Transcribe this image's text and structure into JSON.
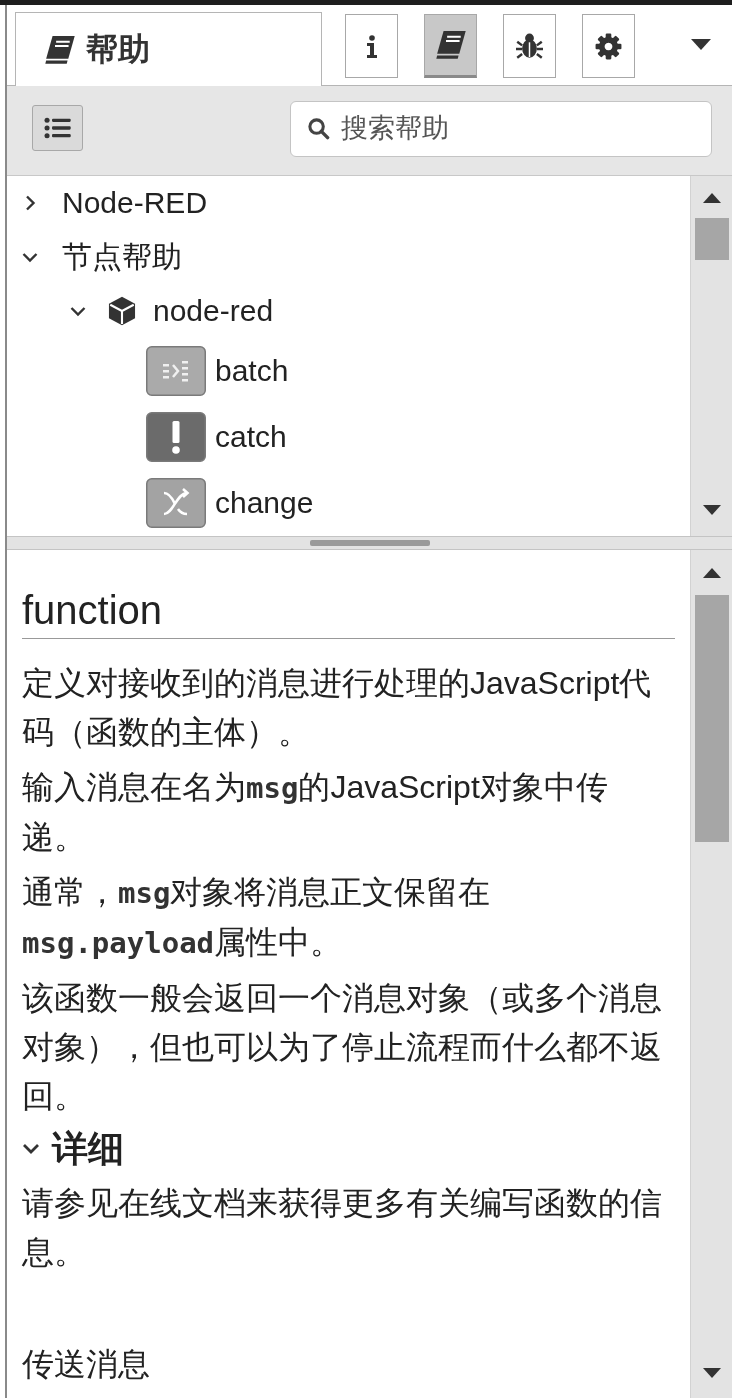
{
  "sidebar_tab": {
    "label": "帮助"
  },
  "sidebar_buttons": [
    {
      "kind": "info",
      "selected": false
    },
    {
      "kind": "book",
      "selected": true
    },
    {
      "kind": "bug",
      "selected": false
    },
    {
      "kind": "gear",
      "selected": false
    }
  ],
  "search": {
    "placeholder": "搜索帮助"
  },
  "tree": [
    {
      "kind": "category",
      "label": "Node-RED",
      "expanded": false
    },
    {
      "kind": "category",
      "label": "节点帮助",
      "expanded": true,
      "children": [
        {
          "kind": "module",
          "label": "node-red",
          "expanded": true,
          "children": [
            {
              "kind": "split",
              "label": "batch",
              "color": "#aaaaaa"
            },
            {
              "kind": "alert",
              "label": "catch",
              "color": "#6b6b6b"
            },
            {
              "kind": "shuffle",
              "label": "change",
              "color": "#a3a3a3"
            }
          ]
        }
      ]
    }
  ],
  "help": {
    "title": "function",
    "blocks": [
      {
        "kind": "paragraph",
        "segments": [
          {
            "kind": "text",
            "text": "定义对接收到的消息进行处理的JavaScript代码（函数的主体）。"
          }
        ]
      },
      {
        "kind": "paragraph",
        "segments": [
          {
            "kind": "text",
            "text": "输入消息在名为"
          },
          {
            "kind": "code",
            "text": "msg"
          },
          {
            "kind": "text",
            "text": "的JavaScript对象中传递。"
          }
        ]
      },
      {
        "kind": "paragraph",
        "segments": [
          {
            "kind": "text",
            "text": "通常，"
          },
          {
            "kind": "code",
            "text": "msg"
          },
          {
            "kind": "text",
            "text": "对象将消息正文保留在"
          },
          {
            "kind": "code",
            "text": "msg.payload"
          },
          {
            "kind": "text",
            "text": "属性中。"
          }
        ]
      },
      {
        "kind": "paragraph",
        "segments": [
          {
            "kind": "text",
            "text": "该函数一般会返回一个消息对象（或多个消息对象），但也可以为了停止流程而什么都不返回。"
          }
        ]
      },
      {
        "kind": "section",
        "label": "详细",
        "expanded": true
      },
      {
        "kind": "paragraph",
        "segments": [
          {
            "kind": "text",
            "text": "请参见在线文档来获得更多有关编写函数的信息。"
          }
        ]
      },
      {
        "kind": "heading",
        "label": "传送消息"
      }
    ]
  }
}
